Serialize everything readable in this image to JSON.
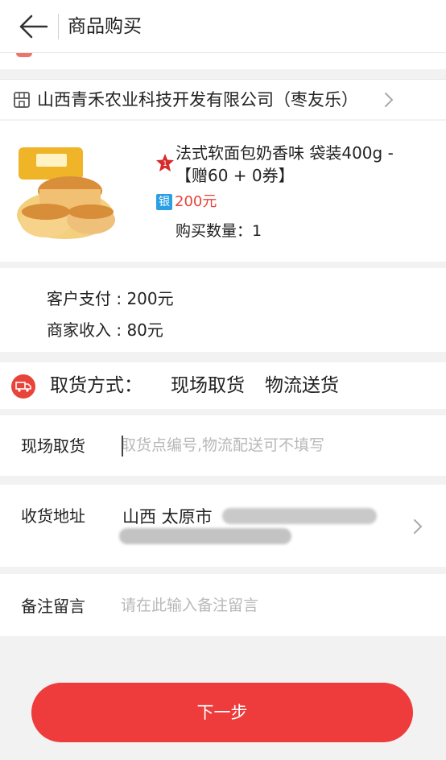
{
  "header": {
    "title": "商品购买"
  },
  "shop": {
    "name": "山西青禾农业科技开发有限公司（枣友乐）"
  },
  "product": {
    "name_line1": "法式软面包奶香味 袋装400g -",
    "name_line2": "【赠60 + 0券】",
    "badge": "银",
    "price": "200元",
    "quantity": "购买数量：1"
  },
  "payment": {
    "customer": "客户支付 : 200元",
    "merchant": "商家收入 : 80元"
  },
  "pickup": {
    "label": "取货方式：",
    "option_onsite": "现场取货",
    "option_logistics": "物流送货"
  },
  "fields": {
    "onsite_label": "现场取货",
    "onsite_placeholder": "取货点编号,物流配送可不填写",
    "address_label": "收货地址",
    "address_value": "山西 太原市",
    "remark_label": "备注留言",
    "remark_placeholder": "请在此输入备注留言"
  },
  "actions": {
    "next": "下一步"
  },
  "colors": {
    "accent": "#ee3b3b",
    "badge_blue": "#2a9fe4"
  }
}
